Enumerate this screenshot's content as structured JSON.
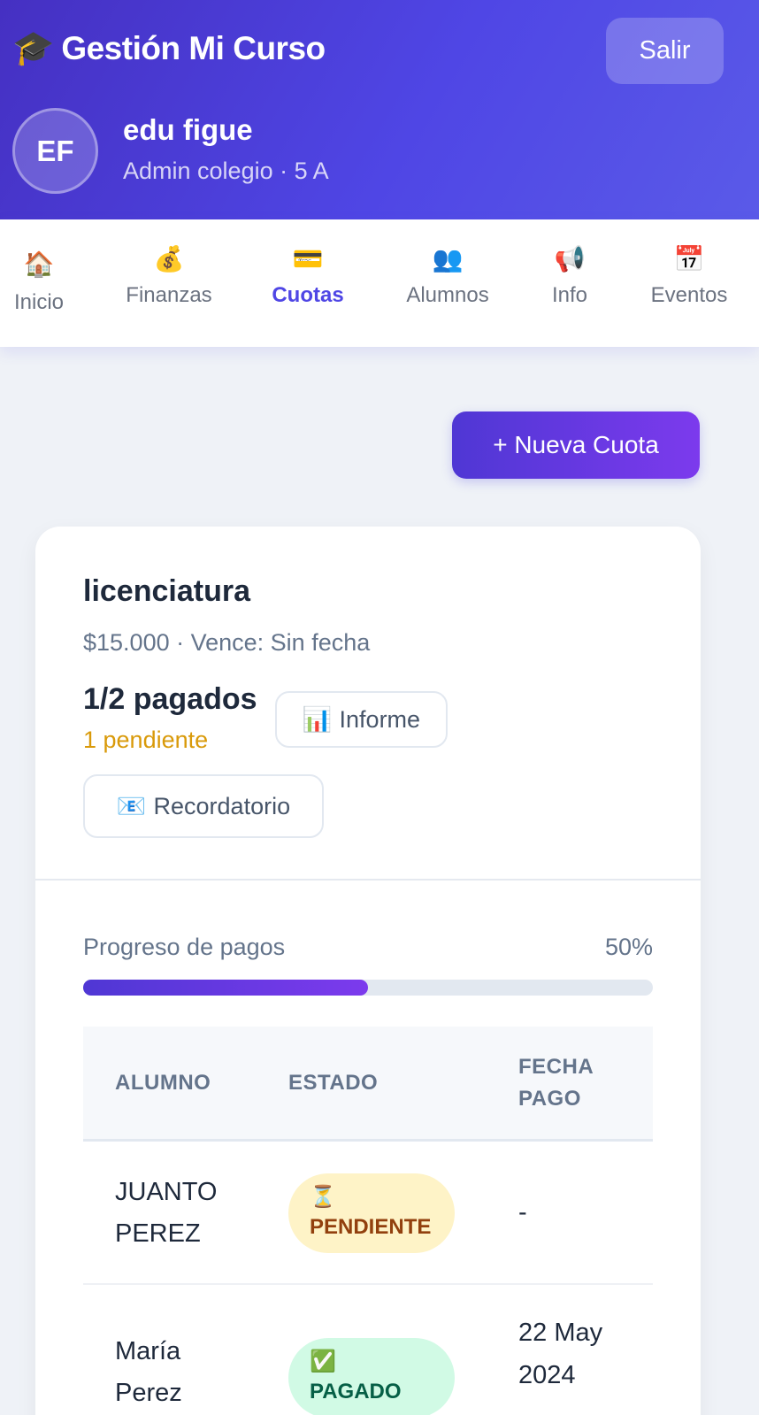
{
  "header": {
    "brand_icon": "graduation-cap-icon",
    "brand_glyph": "🎓",
    "app_title": "Gestión Mi Curso",
    "logout_label": "Salir",
    "user": {
      "initials": "EF",
      "name": "edu figue",
      "role": "Admin colegio · 5 A"
    }
  },
  "nav": {
    "items": [
      {
        "icon": "house-icon",
        "glyph": "🏠",
        "label": "Inicio",
        "active": false
      },
      {
        "icon": "money-bag-icon",
        "glyph": "💰",
        "label": "Finanzas",
        "active": false
      },
      {
        "icon": "credit-card-icon",
        "glyph": "💳",
        "label": "Cuotas",
        "active": true
      },
      {
        "icon": "people-icon",
        "glyph": "👥",
        "label": "Alumnos",
        "active": false
      },
      {
        "icon": "megaphone-icon",
        "glyph": "📢",
        "label": "Info",
        "active": false
      },
      {
        "icon": "calendar-icon",
        "glyph": "📅",
        "label": "Eventos",
        "active": false
      }
    ]
  },
  "actions": {
    "new_fee_label": "+ Nueva Cuota"
  },
  "fee": {
    "name": "licenciatura",
    "meta": "$15.000 · Vence: Sin fecha",
    "paid_summary": "1/2 pagados",
    "pending_summary": "1 pendiente",
    "report_icon": "bar-chart-icon",
    "report_glyph": "📊",
    "report_label": "Informe",
    "reminder_icon": "email-icon",
    "reminder_glyph": "📧",
    "reminder_label": "Recordatorio",
    "progress_label": "Progreso de pagos",
    "progress_text": "50%",
    "progress_fraction": 0.5
  },
  "table": {
    "headers": [
      "ALUMNO",
      "ESTADO",
      "FECHA PAGO"
    ],
    "rows": [
      {
        "student": "JUANTO PEREZ",
        "status_icon": "hourglass-icon",
        "status_glyph": "⏳",
        "status": "PENDIENTE",
        "date": "-"
      },
      {
        "student": "María Perez",
        "status_icon": "check-mark-icon",
        "status_glyph": "✅",
        "status": "PAGADO",
        "date": "22 May 2024"
      }
    ]
  },
  "colors": {
    "primary": "#4f46e5",
    "accent": "#7c3aed",
    "pending": "#d99a0a",
    "pending_badge_bg": "#fef3c7",
    "paid_badge_bg": "#d1fae5"
  }
}
